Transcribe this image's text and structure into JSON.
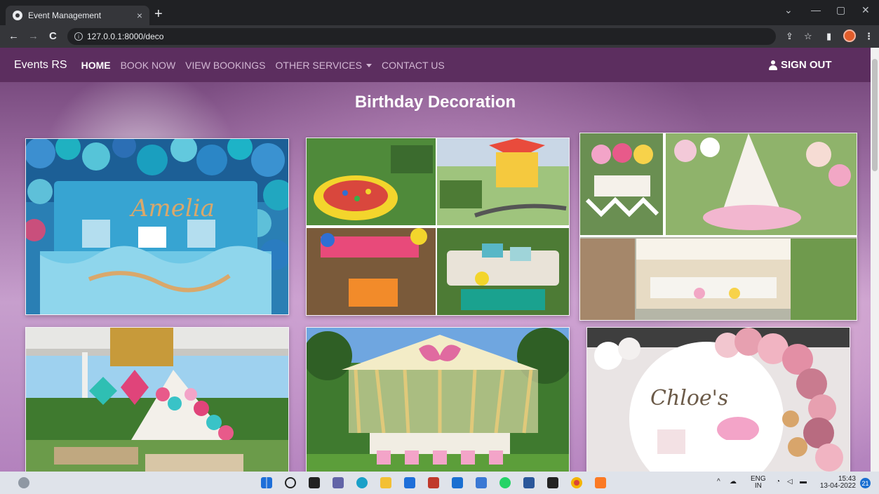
{
  "browser": {
    "tab_title": "Event Management",
    "tab_close": "×",
    "new_tab": "+",
    "url": "127.0.0.1:8000/deco",
    "back": "←",
    "forward": "→",
    "reload": "C",
    "share": "⇪",
    "bookmark": "☆",
    "sidebar": "▮",
    "menu": "⋮",
    "minimize": "—",
    "restore": "▢",
    "close": "✕",
    "collapse": "⌄"
  },
  "navbar": {
    "brand": "Events RS",
    "links": [
      {
        "label": "HOME",
        "active": true
      },
      {
        "label": "BOOK NOW",
        "active": false
      },
      {
        "label": "VIEW BOOKINGS",
        "active": false
      },
      {
        "label": "OTHER SERVICES",
        "active": false,
        "dropdown": true
      },
      {
        "label": "CONTACT US",
        "active": false
      }
    ],
    "signout": "SIGN OUT"
  },
  "page": {
    "title": "Birthday Decoration",
    "photos": [
      {
        "name": "photo-blue-balloon-backdrop",
        "overlay_text": "Amelia"
      },
      {
        "name": "photo-garden-party-collage",
        "overlay_text": ""
      },
      {
        "name": "photo-pastel-picnic-collage",
        "overlay_text": ""
      },
      {
        "name": "photo-pergola-tent-party",
        "overlay_text": ""
      },
      {
        "name": "photo-butterfly-canopy",
        "overlay_text": ""
      },
      {
        "name": "photo-pink-balloon-arch",
        "overlay_text": "Chloe's"
      }
    ]
  },
  "taskbar": {
    "lang_top": "ENG",
    "lang_bottom": "IN",
    "time": "15:43",
    "date": "13-04-2022",
    "notifications": "21"
  }
}
